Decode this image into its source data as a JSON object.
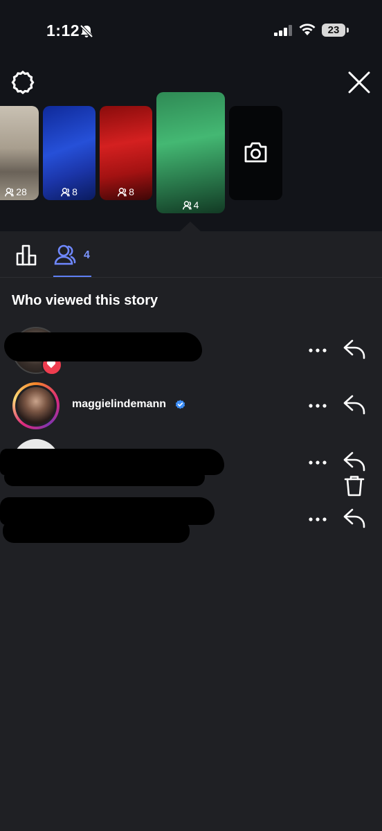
{
  "status_bar": {
    "time": "1:12",
    "battery": "23",
    "icons": [
      "bell-slash-icon",
      "signal-icon",
      "wifi-icon",
      "battery-icon"
    ]
  },
  "top_bar": {
    "left_icon": "gear-icon",
    "right_icon": "close-icon"
  },
  "stories": [
    {
      "viewers": "28"
    },
    {
      "viewers": "8"
    },
    {
      "viewers": "8"
    },
    {
      "viewers": "4",
      "selected": true
    }
  ],
  "add_story_icon": "camera-icon",
  "tabs": {
    "insights_icon": "bar-chart-icon",
    "viewers_icon": "people-icon",
    "viewer_count": "4",
    "delete_icon": "trash-icon"
  },
  "section_title": "Who viewed this story",
  "viewers": [
    {
      "username": "",
      "liked": true,
      "redacted": true
    },
    {
      "username": "maggielindemann",
      "verified": true
    },
    {
      "username": "",
      "redacted": true
    },
    {
      "username": "",
      "redacted": true
    }
  ],
  "colors": {
    "background": "#1f2024",
    "header_background": "#121419",
    "accent": "#5f7ff5",
    "like": "#ef3d4f",
    "verified": "#3d8ef7"
  }
}
